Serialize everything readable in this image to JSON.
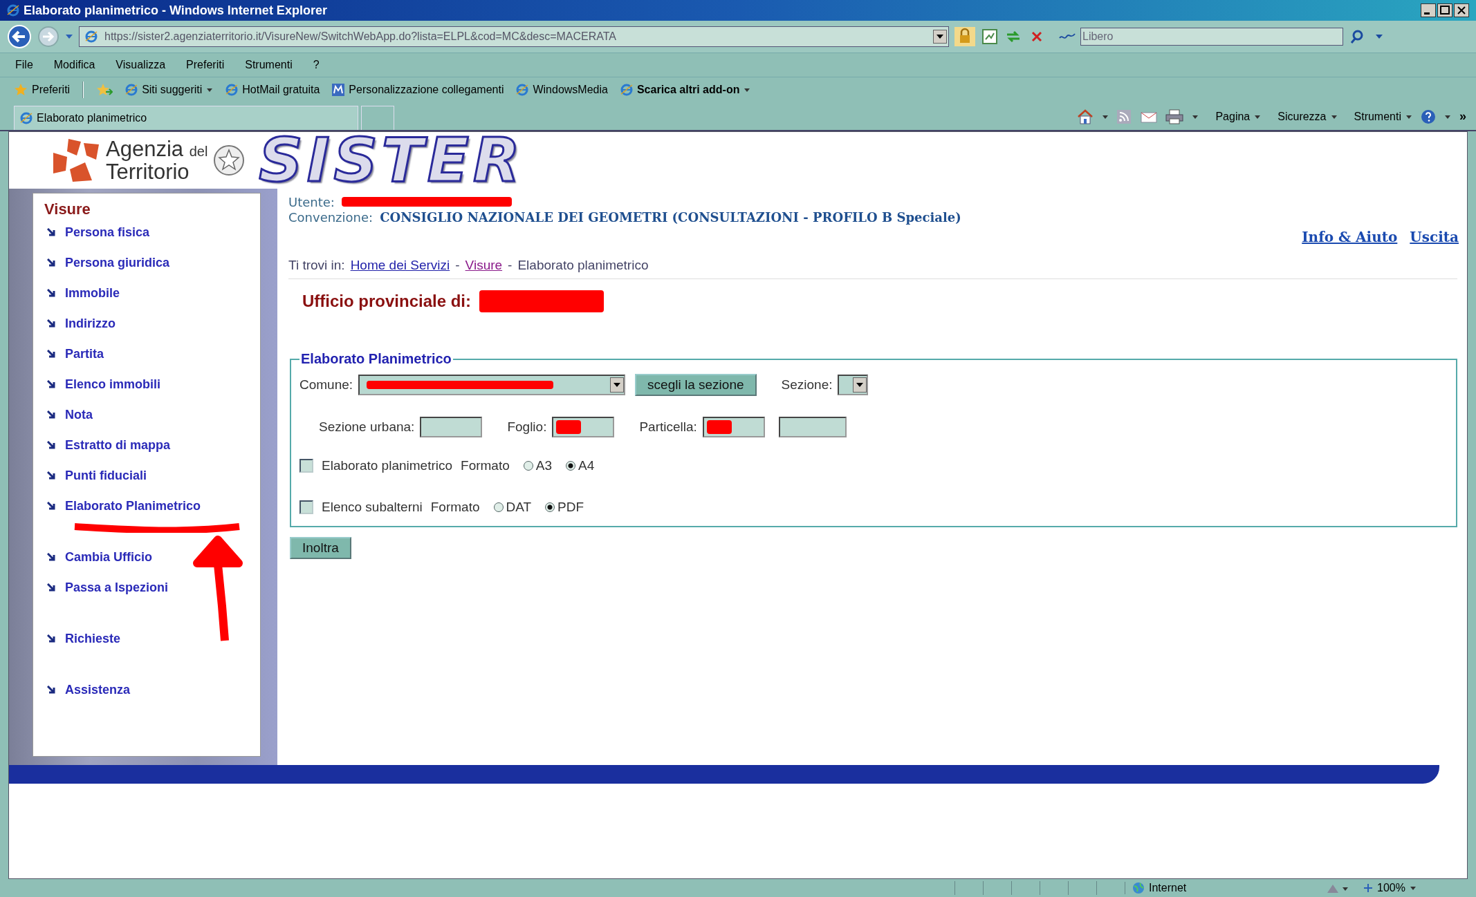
{
  "window": {
    "title": "Elaborato planimetrico - Windows Internet Explorer"
  },
  "address_bar": {
    "url": "https://sister2.agenziaterritorio.it/VisureNew/SwitchWebApp.do?lista=ELPL&cod=MC&desc=MACERATA"
  },
  "search_box": {
    "placeholder": "Libero"
  },
  "menu_bar": [
    "File",
    "Modifica",
    "Visualizza",
    "Preferiti",
    "Strumenti",
    "?"
  ],
  "favorites_bar": {
    "label": "Preferiti",
    "items": [
      {
        "label": "Siti suggeriti",
        "dropdown": true
      },
      {
        "label": "HotMail gratuita",
        "dropdown": false
      },
      {
        "label": "Personalizzazione collegamenti",
        "dropdown": false
      },
      {
        "label": "WindowsMedia",
        "dropdown": false
      },
      {
        "label": "Scarica altri add-on",
        "dropdown": true
      }
    ]
  },
  "tabs": [
    {
      "label": "Elaborato planimetrico",
      "selected": true
    }
  ],
  "command_bar": {
    "items": [
      "Pagina",
      "Sicurezza",
      "Strumenti"
    ],
    "overflow": "»"
  },
  "header": {
    "agency": "Agenzia",
    "agency_small": "del",
    "agency_line2": "Territorio",
    "product": "SISTER"
  },
  "sidebar": {
    "title": "Visure",
    "groups": [
      [
        "Persona fisica",
        "Persona giuridica",
        "Immobile",
        "Indirizzo",
        "Partita",
        "Elenco immobili",
        "Nota",
        "Estratto di mappa",
        "Punti fiduciali",
        "Elaborato Planimetrico"
      ],
      [
        "Cambia Ufficio",
        "Passa a Ispezioni"
      ],
      [
        "Richieste"
      ],
      [
        "Assistenza"
      ]
    ]
  },
  "user": {
    "label": "Utente:",
    "redacted": true,
    "convention_label": "Convenzione:",
    "convention": "CONSIGLIO NAZIONALE DEI GEOMETRI (CONSULTAZIONI - PROFILO B Speciale)"
  },
  "top_links": [
    "Info & Aiuto",
    "Uscita"
  ],
  "breadcrumb": {
    "prefix": "Ti trovi in:",
    "links": [
      "Home dei Servizi",
      "Visure"
    ],
    "separator": "-",
    "current": "Elaborato planimetrico"
  },
  "office": {
    "label": "Ufficio provinciale di:",
    "redacted": true
  },
  "form": {
    "legend": "Elaborato Planimetrico",
    "comune_label": "Comune:",
    "comune_redacted": true,
    "section_button": "scegli la sezione",
    "sezione_label": "Sezione:",
    "fields": [
      {
        "label": "Sezione urbana:",
        "redacted": false
      },
      {
        "label": "Foglio:",
        "redacted": true
      },
      {
        "label": "Particella:",
        "redacted": true,
        "extra_field": true
      }
    ],
    "options": [
      {
        "label": "Elaborato planimetrico",
        "checked": false,
        "format_label": "Formato",
        "formats": [
          {
            "label": "A3",
            "selected": false
          },
          {
            "label": "A4",
            "selected": true
          }
        ]
      },
      {
        "label": "Elenco subalterni",
        "checked": false,
        "format_label": "Formato",
        "formats": [
          {
            "label": "DAT",
            "selected": false
          },
          {
            "label": "PDF",
            "selected": true
          }
        ]
      }
    ],
    "submit": "Inoltra"
  },
  "status_bar": {
    "zone": "Internet",
    "zoom": "100%"
  }
}
